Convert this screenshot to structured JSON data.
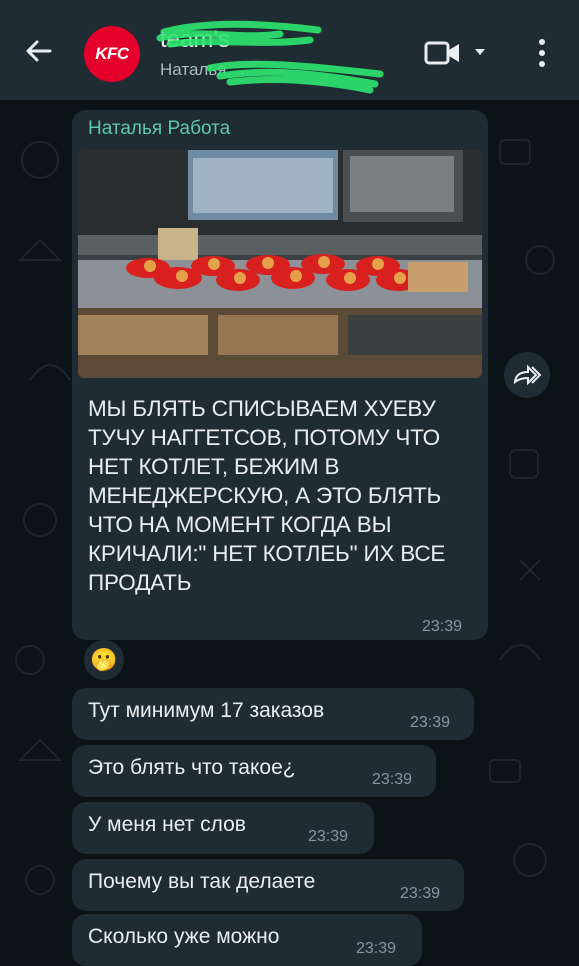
{
  "header": {
    "title": "team's",
    "subtitle": "Наталья, ...",
    "avatar_text": "KFC",
    "icons": [
      "back-arrow-icon",
      "video-call-icon",
      "chevron-down-icon",
      "more-vert-icon"
    ]
  },
  "messages": [
    {
      "sender": "Наталья Работа",
      "text": "МЫ БЛЯТЬ СПИСЫВАЕМ ХУЕВУ ТУЧУ НАГГЕТСОВ, ПОТОМУ ЧТО НЕТ КОТЛЕТ, БЕЖИМ В МЕНЕДЖЕРСКУЮ, А ЭТО БЛЯТЬ ЧТО НА МОМЕНТ КОГДА ВЫ КРИЧАЛИ:\" НЕТ КОТЛЕЬ\" ИХ ВСЕ ПРОДАТЬ",
      "time": "23:39"
    }
  ],
  "reaction_emoji": "🫢",
  "replies": [
    {
      "text": "Тут минимум 17 заказов",
      "time": "23:39"
    },
    {
      "text": "Это блять что такое¿",
      "time": "23:39"
    },
    {
      "text": "У меня нет слов",
      "time": "23:39"
    },
    {
      "text": "Почему вы так делаете",
      "time": "23:39"
    },
    {
      "text": "Сколько уже можно",
      "time": "23:39"
    }
  ],
  "colors": {
    "background": "#0b1317",
    "bubble": "#1f2c33",
    "sender": "#5fc9a8",
    "time": "#8696a0",
    "brand": "#e4002b"
  }
}
